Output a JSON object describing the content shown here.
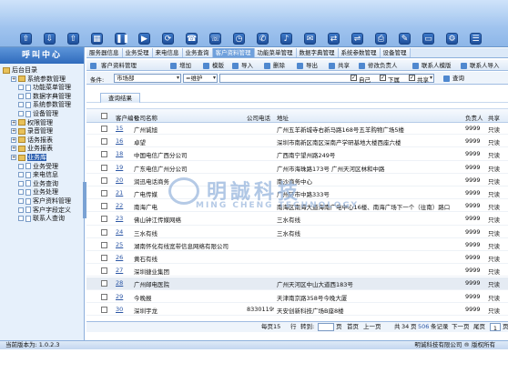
{
  "toolbar": {
    "icons": [
      "user-add-icon",
      "user-download-icon",
      "user-remove-icon",
      "grid-icon",
      "pause-icon",
      "play-icon",
      "refresh-icon",
      "phone-transfer-icon",
      "phone-icon",
      "clock-icon",
      "phone-hangup-icon",
      "sound-icon",
      "chat-icon",
      "transfer-icon",
      "shuffle-icon",
      "print-icon",
      "tools-icon",
      "monitor-icon",
      "settings-icon",
      "list-icon"
    ]
  },
  "sidebar": {
    "title": "呼叫中心",
    "tree": [
      {
        "label": "后台目录",
        "level": 0,
        "kind": "root"
      },
      {
        "label": "系统参数管理",
        "level": 1,
        "kind": "folder"
      },
      {
        "label": "功能菜单管理",
        "level": 2,
        "kind": "page"
      },
      {
        "label": "数据字典管理",
        "level": 2,
        "kind": "page"
      },
      {
        "label": "系统参数管理",
        "level": 2,
        "kind": "page"
      },
      {
        "label": "设备管理",
        "level": 2,
        "kind": "page"
      },
      {
        "label": "权限管理",
        "level": 1,
        "kind": "folder"
      },
      {
        "label": "录音管理",
        "level": 1,
        "kind": "folder"
      },
      {
        "label": "话务报表",
        "level": 1,
        "kind": "folder"
      },
      {
        "label": "业务报表",
        "level": 1,
        "kind": "folder"
      },
      {
        "label": "业务库",
        "level": 1,
        "kind": "folder",
        "selected": true
      },
      {
        "label": "业务受理",
        "level": 2,
        "kind": "page"
      },
      {
        "label": "来电信息",
        "level": 2,
        "kind": "page"
      },
      {
        "label": "业务查询",
        "level": 2,
        "kind": "page"
      },
      {
        "label": "业务处理",
        "level": 2,
        "kind": "page"
      },
      {
        "label": "客户资料管理",
        "level": 2,
        "kind": "page"
      },
      {
        "label": "客户字段定义",
        "level": 2,
        "kind": "page"
      },
      {
        "label": "联系人查询",
        "level": 2,
        "kind": "page"
      }
    ]
  },
  "tabs": [
    "服务器信息",
    "业务受理",
    "来电信息",
    "业务查询",
    "客户资料管理",
    "功能菜单管理",
    "数据字典管理",
    "系统参数管理",
    "设备管理"
  ],
  "active_tab": 4,
  "subbar": {
    "title": "客户资料管理",
    "actions": [
      "增加",
      "模版",
      "导入",
      "删除",
      "导出",
      "共享",
      "修改负责人",
      "联系人模版",
      "联系人导入"
    ]
  },
  "conditions": {
    "label": "条件:",
    "field_value": "市场部",
    "op_value": "=维护",
    "options": [
      "自己",
      "下属",
      "共享"
    ],
    "query_label": "查询"
  },
  "result_tab": "查询结果",
  "grid": {
    "headers": [
      "客户编号",
      "公司名称",
      "公司电话",
      "地址",
      "负责人",
      "共享"
    ],
    "rows": [
      {
        "id": "15",
        "name": "广州诚旭",
        "phone": "",
        "addr": "广州五羊新城寺右新马路168号五羊购物广场5楼",
        "owner": "9999",
        "share": "只读"
      },
      {
        "id": "16",
        "name": "卓望",
        "phone": "",
        "addr": "深圳市南新区南区深南产学研基地大楼西座六楼",
        "owner": "9999",
        "share": "只读"
      },
      {
        "id": "18",
        "name": "中国电信广西分公司",
        "phone": "",
        "addr": "广西南宁望州路249号",
        "owner": "9999",
        "share": "只读"
      },
      {
        "id": "19",
        "name": "广东电信广州分公司",
        "phone": "",
        "addr": "广州市海珠路173号 广州天河区林和中路",
        "owner": "9999",
        "share": "只读"
      },
      {
        "id": "20",
        "name": "润迅电话商务",
        "phone": "",
        "addr": "南沙商务中心",
        "owner": "9999",
        "share": "只读"
      },
      {
        "id": "21",
        "name": "广电传媒",
        "phone": "",
        "addr": "广州环市中路333号",
        "owner": "9999",
        "share": "只读"
      },
      {
        "id": "22",
        "name": "南海广电",
        "phone": "",
        "addr": "南海区南海大道海南广电中心16楼、南海广场下一个（往南）路口",
        "owner": "9999",
        "share": "只读"
      },
      {
        "id": "23",
        "name": "佛山钟江传媒网络",
        "phone": "",
        "addr": "三水有线",
        "owner": "9999",
        "share": "只读"
      },
      {
        "id": "24",
        "name": "三水有线",
        "phone": "",
        "addr": "三水有线",
        "owner": "9999",
        "share": "只读"
      },
      {
        "id": "25",
        "name": "湖南怀化有线宽带信息网络有限公司",
        "phone": "",
        "addr": "",
        "owner": "9999",
        "share": "只读"
      },
      {
        "id": "26",
        "name": "黄石有线",
        "phone": "",
        "addr": "",
        "owner": "9999",
        "share": "只读"
      },
      {
        "id": "27",
        "name": "深圳捷业集团",
        "phone": "",
        "addr": "",
        "owner": "9999",
        "share": "只读"
      },
      {
        "id": "28",
        "name": "广州邮电医院",
        "phone": "",
        "addr": "广州天河区中山大道西183号",
        "owner": "9999",
        "share": "只读",
        "highlight": true
      },
      {
        "id": "29",
        "name": "今晚报",
        "phone": "",
        "addr": "天津南京路358号今晚大厦",
        "owner": "9999",
        "share": "只读"
      },
      {
        "id": "30",
        "name": "深圳宇龙",
        "phone": "83301199",
        "addr": "天安创新科技广场B座8楼",
        "owner": "9999",
        "share": "只读"
      }
    ]
  },
  "pager": {
    "per_page_label": "每页15",
    "rows_label": "行",
    "goto_label": "转到:",
    "page_label": "页",
    "first_label": "首页",
    "prev_label": "上一页",
    "current_page": "1",
    "total_label": "共",
    "total_pages": "34",
    "pages_suffix": "页",
    "total_records": "506",
    "records_label": "条记录",
    "next_label": "下一页",
    "last_label": "尾页"
  },
  "status": {
    "version": "当前版本为: 1.0.2.3",
    "copyright": "明诚科技有限公司 ® 版权所有"
  },
  "watermark": {
    "cn": "明誠科技",
    "en": "MING CHENG TECHNOLOGY"
  }
}
